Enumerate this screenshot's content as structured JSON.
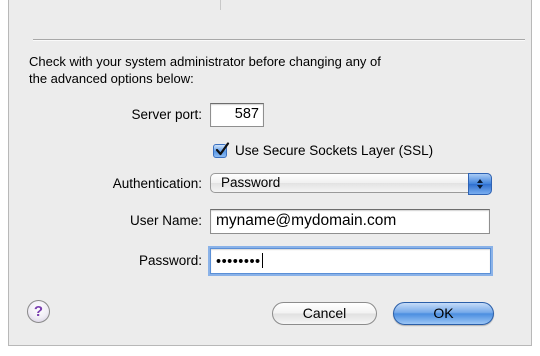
{
  "instructions": {
    "line1": "Check with your system administrator before changing any of",
    "line2": "the advanced options below:"
  },
  "server_port": {
    "label": "Server port:",
    "value": "587"
  },
  "ssl": {
    "label": "Use Secure Sockets Layer (SSL)",
    "checked": true
  },
  "authentication": {
    "label": "Authentication:",
    "value": "Password"
  },
  "user_name": {
    "label": "User Name:",
    "value": "myname@mydomain.com"
  },
  "password": {
    "label": "Password:",
    "masked_value": "••••••••"
  },
  "help": {
    "glyph": "?"
  },
  "buttons": {
    "cancel": "Cancel",
    "ok": "OK"
  },
  "colors": {
    "accent": "#4b8ee0",
    "focus_ring": "#8ab2e8"
  }
}
